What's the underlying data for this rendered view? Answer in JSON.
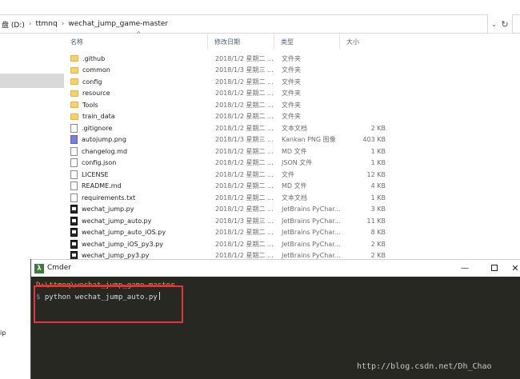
{
  "explorer": {
    "breadcrumb": [
      "盘 (D:)",
      "ttmnq",
      "wechat_jump_game-master"
    ],
    "columns": {
      "name": "名称",
      "date": "修改日期",
      "type": "类型",
      "size": "大小"
    },
    "rows": [
      {
        "name": ".github",
        "date": "2018/1/2 星期二 ...",
        "type": "文件夹",
        "size": "",
        "icon": "folder-icon"
      },
      {
        "name": "common",
        "date": "2018/1/3 星期三 ...",
        "type": "文件夹",
        "size": "",
        "icon": "folder-icon"
      },
      {
        "name": "config",
        "date": "2018/1/2 星期二 ...",
        "type": "文件夹",
        "size": "",
        "icon": "folder-icon"
      },
      {
        "name": "resource",
        "date": "2018/1/2 星期二 ...",
        "type": "文件夹",
        "size": "",
        "icon": "folder-icon"
      },
      {
        "name": "Tools",
        "date": "2018/1/2 星期二 ...",
        "type": "文件夹",
        "size": "",
        "icon": "folder-icon"
      },
      {
        "name": "train_data",
        "date": "2018/1/2 星期二 ...",
        "type": "文件夹",
        "size": "",
        "icon": "folder-icon"
      },
      {
        "name": ".gitignore",
        "date": "2018/1/2 星期二 ...",
        "type": "文本文档",
        "size": "2 KB",
        "icon": "text-file-icon"
      },
      {
        "name": "autojump.png",
        "date": "2018/1/3 星期三 ...",
        "type": "Kankan PNG 图像",
        "size": "403 KB",
        "icon": "png-file-icon"
      },
      {
        "name": "changelog.md",
        "date": "2018/1/2 星期二 ...",
        "type": "MD 文件",
        "size": "1 KB",
        "icon": "file-icon"
      },
      {
        "name": "config.json",
        "date": "2018/1/2 星期二 ...",
        "type": "JSON 文件",
        "size": "1 KB",
        "icon": "file-icon"
      },
      {
        "name": "LICENSE",
        "date": "2018/1/2 星期二 ...",
        "type": "文件",
        "size": "12 KB",
        "icon": "file-icon"
      },
      {
        "name": "README.md",
        "date": "2018/1/2 星期二 ...",
        "type": "MD 文件",
        "size": "4 KB",
        "icon": "file-icon"
      },
      {
        "name": "requirements.txt",
        "date": "2018/1/2 星期二 ...",
        "type": "文本文档",
        "size": "1 KB",
        "icon": "text-file-icon"
      },
      {
        "name": "wechat_jump.py",
        "date": "2018/1/2 星期二 ...",
        "type": "JetBrains PyChar...",
        "size": "3 KB",
        "icon": "python-file-icon"
      },
      {
        "name": "wechat_jump_auto.py",
        "date": "2018/1/3 星期三 ...",
        "type": "JetBrains PyChar...",
        "size": "11 KB",
        "icon": "python-file-icon"
      },
      {
        "name": "wechat_jump_auto_iOS.py",
        "date": "2018/1/2 星期二 ...",
        "type": "JetBrains PyChar...",
        "size": "8 KB",
        "icon": "python-file-icon"
      },
      {
        "name": "wechat_jump_iOS_py3.py",
        "date": "2018/1/2 星期二 ...",
        "type": "JetBrains PyChar...",
        "size": "2 KB",
        "icon": "python-file-icon"
      },
      {
        "name": "wechat_jump_py3.py",
        "date": "2018/1/2 星期二 ...",
        "type": "JetBrains PyChar...",
        "size": "2 KB",
        "icon": "python-file-icon"
      }
    ],
    "left_strip_text": "ip"
  },
  "cmder": {
    "title": "Cmder",
    "logo": "λ",
    "path": "D:\\ttmnq\\wechat_jump_game-master",
    "prompt": "$",
    "command": "python wechat_jump_auto.py"
  },
  "watermark": "http://blog.csdn.net/Dh_Chao",
  "colors": {
    "terminal_bg": "#272822",
    "path_color": "#d7a043",
    "highlight_box": "#e0383e",
    "folder_color": "#f7d26b"
  }
}
